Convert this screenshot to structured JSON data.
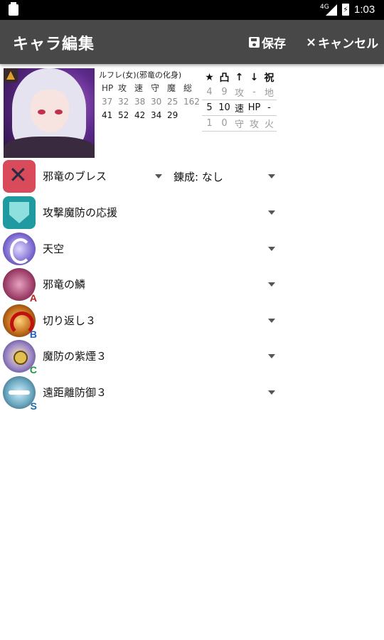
{
  "status_bar": {
    "network": "4G",
    "time": "1:03"
  },
  "app_bar": {
    "title": "キャラ編集",
    "save_label": "保存",
    "cancel_label": "キャンセル"
  },
  "unit": {
    "name": "ルフレ(女)(邪竜の化身)",
    "stat_headers": [
      "HP",
      "攻",
      "速",
      "守",
      "魔",
      "総"
    ],
    "stats_base": [
      "37",
      "32",
      "38",
      "30",
      "25",
      "162"
    ],
    "stats_max": [
      "41",
      "52",
      "42",
      "34",
      "29"
    ]
  },
  "mini_table": {
    "headers": [
      "★",
      "凸",
      "↑",
      "↓",
      "祝"
    ],
    "rows": [
      [
        "4",
        "9",
        "攻",
        "-",
        "地"
      ],
      [
        "5",
        "10",
        "速",
        "HP",
        "-"
      ],
      [
        "1",
        "0",
        "守",
        "攻",
        "火"
      ]
    ]
  },
  "skills": {
    "weapon": {
      "name": "邪竜のブレス",
      "icon": "crossed-swords-icon"
    },
    "refine": {
      "label": "錬成:",
      "value": "なし"
    },
    "assist": {
      "name": "攻撃魔防の応援",
      "icon": "shield-icon"
    },
    "special": {
      "name": "天空",
      "icon": "crescent-moon-icon"
    },
    "a": {
      "name": "邪竜の鱗",
      "slot": "A",
      "icon": "dragon-scale-icon"
    },
    "b": {
      "name": "切り返し３",
      "slot": "B",
      "icon": "counter-arrow-icon"
    },
    "c": {
      "name": "魔防の紫煙３",
      "slot": "C",
      "icon": "smoke-icon"
    },
    "s": {
      "name": "遠距離防御３",
      "slot": "S",
      "icon": "distant-defense-icon"
    }
  },
  "colors": {
    "app_bar": "#484848",
    "status_bar": "#000000",
    "badge_a": "#c02020",
    "badge_b": "#1f5ccf",
    "badge_c": "#1a9a3a",
    "badge_s": "#1a6aaa"
  }
}
